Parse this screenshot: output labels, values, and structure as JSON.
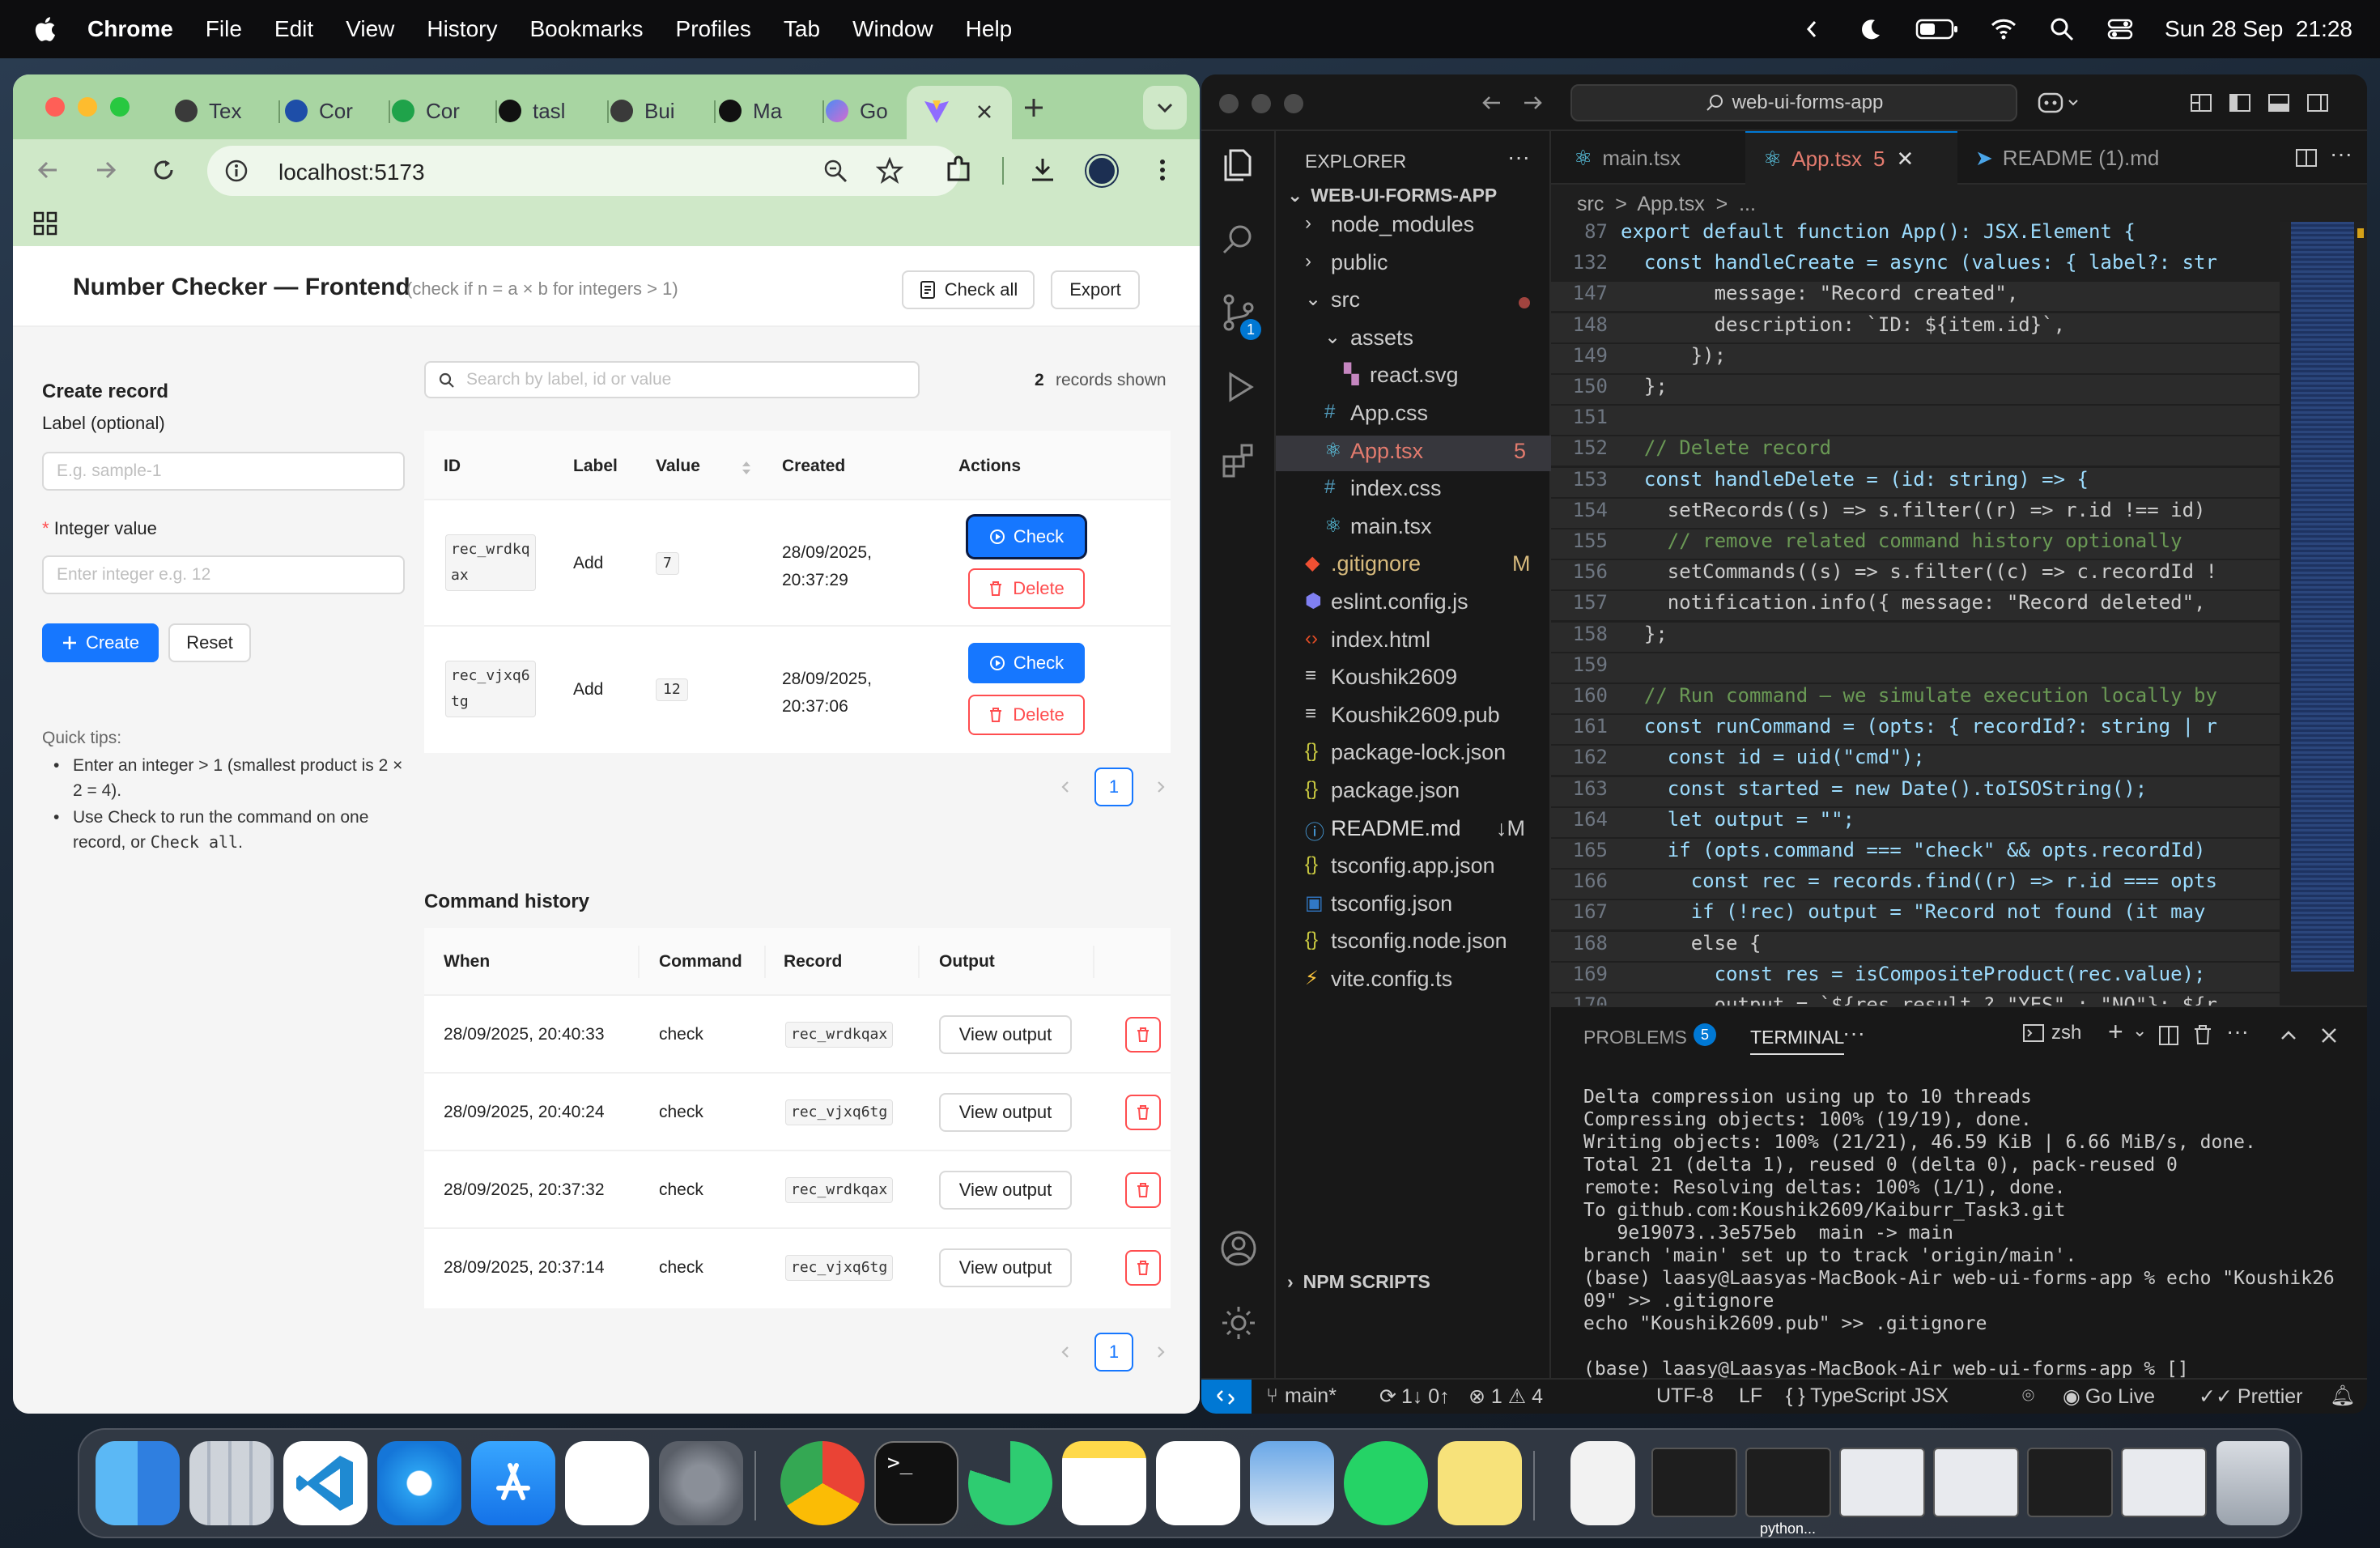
{
  "menubar": {
    "items": [
      "Chrome",
      "File",
      "Edit",
      "View",
      "History",
      "Bookmarks",
      "Profiles",
      "Tab",
      "Window",
      "Help"
    ],
    "datetime": "Sun 28 Sep  21:28"
  },
  "chrome": {
    "tabs": [
      "Tex",
      "Cor",
      "Cor",
      "tasl",
      "Bui",
      "Ma",
      "Go"
    ],
    "url": "localhost:5173"
  },
  "app": {
    "title": "Number Checker — Frontend",
    "subtitle": "(check if n = a × b for integers > 1)",
    "check_all": "Check all",
    "export": "Export",
    "create_heading": "Create record",
    "label_field": "Label (optional)",
    "label_placeholder": "E.g. sample-1",
    "integer_required": "*",
    "integer_field": "Integer value",
    "integer_placeholder": "Enter integer e.g. 12",
    "create_btn": "Create",
    "reset_btn": "Reset",
    "tips_heading": "Quick tips:",
    "tip1": "Enter an integer > 1 (smallest product is 2 × 2 = 4).",
    "tip2_a": "Use ",
    "tip2_b": "Check",
    "tip2_c": " to run the command on one record, or ",
    "tip2_d": "Check all",
    "tip2_e": ".",
    "search_placeholder": "Search by label, id or value",
    "records_count": "2",
    "records_shown": "records shown",
    "columns": [
      "ID",
      "Label",
      "Value",
      "Created",
      "Actions"
    ],
    "records": [
      {
        "id_a": "rec_wrdkq",
        "id_b": "ax",
        "label": "Add",
        "value": "7",
        "created_a": "28/09/2025,",
        "created_b": "20:37:29"
      },
      {
        "id_a": "rec_vjxq6",
        "id_b": "tg",
        "label": "Add",
        "value": "12",
        "created_a": "28/09/2025,",
        "created_b": "20:37:06"
      }
    ],
    "check_btn": "Check",
    "delete_btn": "Delete",
    "page": "1",
    "history_heading": "Command history",
    "history_columns": [
      "When",
      "Command",
      "Record",
      "Output"
    ],
    "history": [
      {
        "when": "28/09/2025, 20:40:33",
        "command": "check",
        "record": "rec_wrdkqax"
      },
      {
        "when": "28/09/2025, 20:40:24",
        "command": "check",
        "record": "rec_vjxq6tg"
      },
      {
        "when": "28/09/2025, 20:37:32",
        "command": "check",
        "record": "rec_wrdkqax"
      },
      {
        "when": "28/09/2025, 20:37:14",
        "command": "check",
        "record": "rec_vjxq6tg"
      }
    ],
    "view_output": "View output"
  },
  "vscode": {
    "search": "web-ui-forms-app",
    "explorer": "EXPLORER",
    "project": "WEB-UI-FORMS-APP",
    "tree": [
      {
        "name": "node_modules",
        "icon": ">"
      },
      {
        "name": "public",
        "icon": ">"
      },
      {
        "name": "src",
        "icon": "v"
      },
      {
        "name": "assets",
        "icon": "v"
      },
      {
        "name": "react.svg",
        "icon": "svg"
      },
      {
        "name": "App.css",
        "icon": "#"
      },
      {
        "name": "App.tsx",
        "icon": "react"
      },
      {
        "name": "index.css",
        "icon": "#"
      },
      {
        "name": "main.tsx",
        "icon": "react"
      },
      {
        "name": ".gitignore",
        "icon": "git"
      },
      {
        "name": "eslint.config.js",
        "icon": "eslint"
      },
      {
        "name": "index.html",
        "icon": "html"
      },
      {
        "name": "Koushik2609",
        "icon": "file"
      },
      {
        "name": "Koushik2609.pub",
        "icon": "file"
      },
      {
        "name": "package-lock.json",
        "icon": "json"
      },
      {
        "name": "package.json",
        "icon": "json"
      },
      {
        "name": "README.md",
        "icon": "info"
      },
      {
        "name": "tsconfig.app.json",
        "icon": "json"
      },
      {
        "name": "tsconfig.json",
        "icon": "ts"
      },
      {
        "name": "tsconfig.node.json",
        "icon": "json"
      },
      {
        "name": "vite.config.ts",
        "icon": "vite"
      }
    ],
    "badge_5": "5",
    "badge_m": "M",
    "badge_dm": "↓M",
    "npm_scripts": "NPM SCRIPTS",
    "editor_tabs": [
      "main.tsx",
      "App.tsx",
      "README (1).md"
    ],
    "breadcrumb": "src  >  App.tsx  >  ...",
    "code": [
      {
        "n": "87",
        "t": "export default function App(): JSX.Element {"
      },
      {
        "n": "132",
        "t": "  const handleCreate = async (values: { label?: str"
      },
      {
        "n": "147",
        "t": "        message: \"Record created\","
      },
      {
        "n": "148",
        "t": "        description: `ID: ${item.id}`,"
      },
      {
        "n": "149",
        "t": "      });"
      },
      {
        "n": "150",
        "t": "  };"
      },
      {
        "n": "151",
        "t": ""
      },
      {
        "n": "152",
        "t": "  // Delete record"
      },
      {
        "n": "153",
        "t": "  const handleDelete = (id: string) => {"
      },
      {
        "n": "154",
        "t": "    setRecords((s) => s.filter((r) => r.id !== id)"
      },
      {
        "n": "155",
        "t": "    // remove related command history optionally"
      },
      {
        "n": "156",
        "t": "    setCommands((s) => s.filter((c) => c.recordId !"
      },
      {
        "n": "157",
        "t": "    notification.info({ message: \"Record deleted\","
      },
      {
        "n": "158",
        "t": "  };"
      },
      {
        "n": "159",
        "t": ""
      },
      {
        "n": "160",
        "t": "  // Run command — we simulate execution locally by"
      },
      {
        "n": "161",
        "t": "  const runCommand = (opts: { recordId?: string | r"
      },
      {
        "n": "162",
        "t": "    const id = uid(\"cmd\");"
      },
      {
        "n": "163",
        "t": "    const started = new Date().toISOString();"
      },
      {
        "n": "164",
        "t": "    let output = \"\";"
      },
      {
        "n": "165",
        "t": "    if (opts.command === \"check\" && opts.recordId)"
      },
      {
        "n": "166",
        "t": "      const rec = records.find((r) => r.id === opts"
      },
      {
        "n": "167",
        "t": "      if (!rec) output = \"Record not found (it may"
      },
      {
        "n": "168",
        "t": "      else {"
      },
      {
        "n": "169",
        "t": "        const res = isCompositeProduct(rec.value);"
      },
      {
        "n": "170",
        "t": "        output = `${res.result ? \"YES\" : \"NO\"}: ${r"
      },
      {
        "n": "171",
        "t": "      }"
      }
    ],
    "panel_tabs": [
      "PROBLEMS",
      "TERMINAL"
    ],
    "problems_count": "5",
    "shell": "zsh",
    "terminal": [
      "Delta compression using up to 10 threads",
      "Compressing objects: 100% (19/19), done.",
      "Writing objects: 100% (21/21), 46.59 KiB | 6.66 MiB/s, done.",
      "Total 21 (delta 1), reused 0 (delta 0), pack-reused 0",
      "remote: Resolving deltas: 100% (1/1), done.",
      "To github.com:Koushik2609/Kaiburr_Task3.git",
      "   9e19073..3e575eb  main -> main",
      "branch 'main' set up to track 'origin/main'.",
      "(base) laasy@Laasyas-MacBook-Air web-ui-forms-app % echo \"Koushik26",
      "09\" >> .gitignore",
      "echo \"Koushik2609.pub\" >> .gitignore",
      "",
      "(base) laasy@Laasyas-MacBook-Air web-ui-forms-app % []"
    ],
    "status": {
      "branch": "main*",
      "sync": "1↓ 0↑",
      "problems": "⊗ 1 ⚠ 4",
      "encoding": "UTF-8",
      "eol": "LF",
      "language": "{ } TypeScript JSX",
      "golive": "Go Live",
      "prettier": "Prettier"
    }
  },
  "dock": {
    "thumb_label": "python..."
  }
}
